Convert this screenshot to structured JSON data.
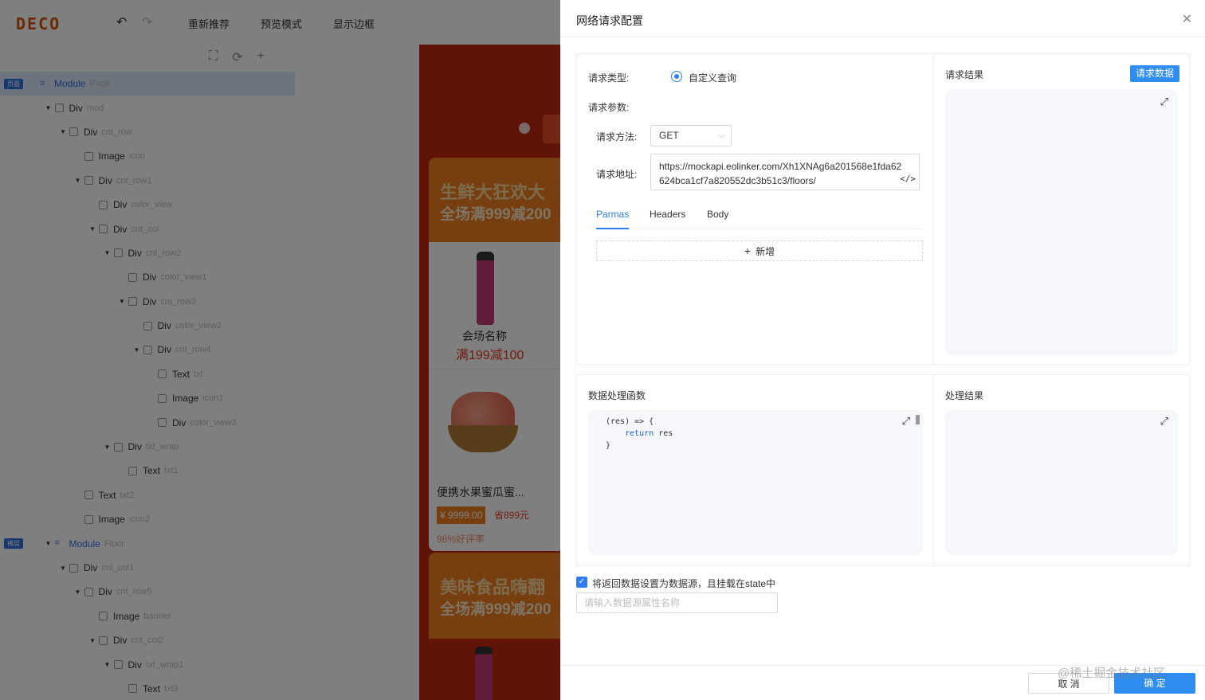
{
  "editor": {
    "logo": "DECO",
    "toolbar": {
      "recommend": "重新推荐",
      "preview": "预览模式",
      "border": "显示边框"
    },
    "tree": [
      {
        "name": "Module",
        "cls": "Page",
        "depth": 0,
        "caret": false,
        "icon": "module",
        "badge": "页面",
        "selected": true
      },
      {
        "name": "Div",
        "cls": "mod",
        "depth": 1,
        "caret": true,
        "icon": "div"
      },
      {
        "name": "Div",
        "cls": "cnt_row",
        "depth": 2,
        "caret": true,
        "icon": "div"
      },
      {
        "name": "Image",
        "cls": "icon",
        "depth": 3,
        "caret": false,
        "icon": "image"
      },
      {
        "name": "Div",
        "cls": "cnt_row1",
        "depth": 3,
        "caret": true,
        "icon": "div"
      },
      {
        "name": "Div",
        "cls": "color_view",
        "depth": 4,
        "caret": false,
        "icon": "div"
      },
      {
        "name": "Div",
        "cls": "cnt_col",
        "depth": 4,
        "caret": true,
        "icon": "div"
      },
      {
        "name": "Div",
        "cls": "cnt_row2",
        "depth": 5,
        "caret": true,
        "icon": "div"
      },
      {
        "name": "Div",
        "cls": "color_view1",
        "depth": 6,
        "caret": false,
        "icon": "div"
      },
      {
        "name": "Div",
        "cls": "cnt_row3",
        "depth": 6,
        "caret": true,
        "icon": "div"
      },
      {
        "name": "Div",
        "cls": "color_view2",
        "depth": 7,
        "caret": false,
        "icon": "div"
      },
      {
        "name": "Div",
        "cls": "cnt_row4",
        "depth": 7,
        "caret": true,
        "icon": "div"
      },
      {
        "name": "Text",
        "cls": "txt",
        "depth": 8,
        "caret": false,
        "icon": "text"
      },
      {
        "name": "Image",
        "cls": "icon1",
        "depth": 8,
        "caret": false,
        "icon": "image"
      },
      {
        "name": "Div",
        "cls": "color_view3",
        "depth": 8,
        "caret": false,
        "icon": "div"
      },
      {
        "name": "Div",
        "cls": "txt_wrap",
        "depth": 5,
        "caret": true,
        "icon": "div"
      },
      {
        "name": "Text",
        "cls": "txt1",
        "depth": 6,
        "caret": false,
        "icon": "text"
      },
      {
        "name": "Text",
        "cls": "txt2",
        "depth": 3,
        "caret": false,
        "icon": "text"
      },
      {
        "name": "Image",
        "cls": "icon2",
        "depth": 3,
        "caret": false,
        "icon": "image"
      },
      {
        "name": "Module",
        "cls": "Floor",
        "depth": 1,
        "caret": true,
        "icon": "module",
        "badge": "楼层"
      },
      {
        "name": "Div",
        "cls": "cnt_col1",
        "depth": 2,
        "caret": true,
        "icon": "div"
      },
      {
        "name": "Div",
        "cls": "cnt_row5",
        "depth": 3,
        "caret": true,
        "icon": "div"
      },
      {
        "name": "Image",
        "cls": "banner",
        "depth": 4,
        "caret": false,
        "icon": "image"
      },
      {
        "name": "Div",
        "cls": "cnt_col2",
        "depth": 4,
        "caret": true,
        "icon": "div"
      },
      {
        "name": "Div",
        "cls": "txt_wrap1",
        "depth": 5,
        "caret": true,
        "icon": "div"
      },
      {
        "name": "Text",
        "cls": "txt3",
        "depth": 6,
        "caret": false,
        "icon": "text"
      }
    ],
    "canvas": {
      "promo1_line1": "生鲜大狂欢大",
      "promo1_line2": "全场满999减200",
      "venue_name": "会场名称",
      "venue_discount": "满199减100",
      "product_name": "便携水果蜜瓜蜜...",
      "product_price": "¥ 9999.00",
      "product_save": "省899元",
      "product_rate": "98%好评率",
      "promo2_line1": "美味食品嗨翻",
      "promo2_line2": "全场满999减200"
    }
  },
  "drawer": {
    "title": "网络请求配置",
    "request": {
      "type_label": "请求类型:",
      "type_value": "自定义查询",
      "params_label": "请求参数:",
      "method_label": "请求方法:",
      "method_value": "GET",
      "url_label": "请求地址:",
      "url_value": "https://mockapi.eolinker.com/Xh1XNAg6a201568e1fda62624bca1cf7a820552dc3b51c3/floors/",
      "tabs": [
        "Parmas",
        "Headers",
        "Body"
      ],
      "add_label": "新增"
    },
    "result": {
      "title": "请求结果",
      "button": "请求数据"
    },
    "function": {
      "title": "数据处理函数",
      "code_line1": "(res) => {",
      "code_kw": "return",
      "code_line2_rest": " res",
      "code_line3": "}"
    },
    "output": {
      "title": "处理结果"
    },
    "datasource": {
      "checkbox_label": "将返回数据设置为数据源，且挂载在state中",
      "checked": true,
      "placeholder": "请输入数据源属性名称"
    },
    "footer": {
      "cancel": "取 消",
      "ok": "确 定",
      "watermark": "@稀土掘金技术社区"
    }
  },
  "colors": {
    "primary": "#2f7cf6",
    "button": "#2f8df0",
    "canvas_bg": "#c1280e",
    "promo": "#ef7d1f"
  }
}
